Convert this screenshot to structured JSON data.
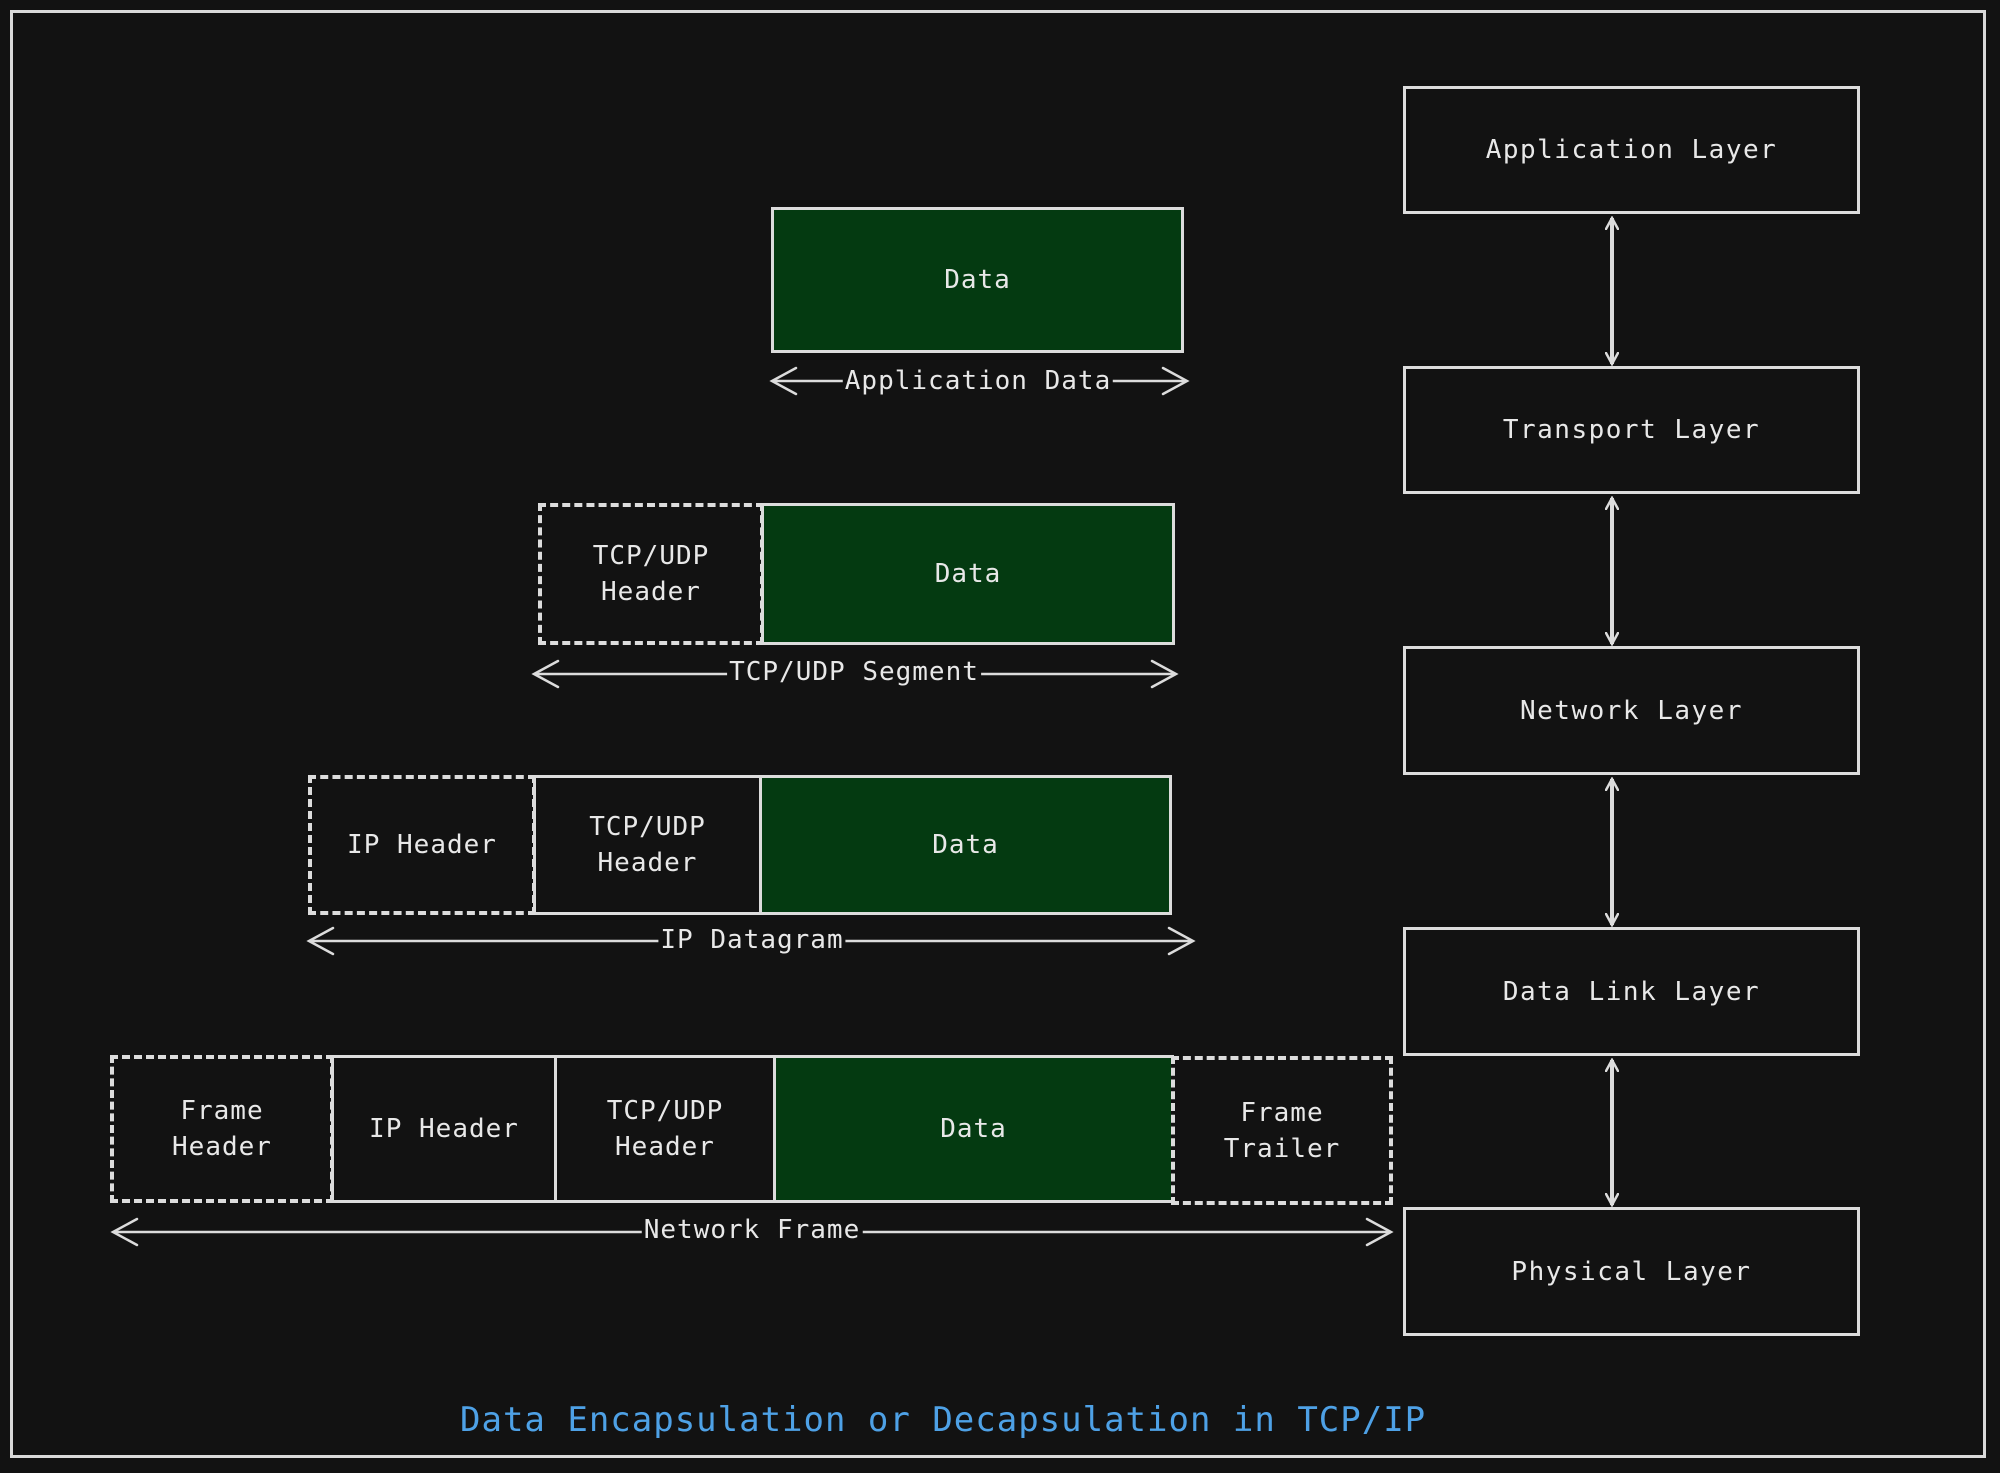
{
  "title": "Data Encapsulation or Decapsulation in TCP/IP",
  "colors": {
    "background": "#121212",
    "stroke": "#dcdcdc",
    "data_fill": "#043a11",
    "title": "#4ea1e6"
  },
  "layers": [
    {
      "label": "Application Layer"
    },
    {
      "label": "Transport Layer"
    },
    {
      "label": "Network Layer"
    },
    {
      "label": "Data Link Layer"
    },
    {
      "label": "Physical Layer"
    }
  ],
  "layer_connectors": "bidirectional",
  "rows": [
    {
      "name": "application",
      "span_label": "Application Data",
      "segments": [
        {
          "label": "Data",
          "style": "data"
        }
      ]
    },
    {
      "name": "transport",
      "span_label": "TCP/UDP Segment",
      "segments": [
        {
          "label": "TCP/UDP\nHeader",
          "style": "dashed"
        },
        {
          "label": "Data",
          "style": "data"
        }
      ]
    },
    {
      "name": "network",
      "span_label": "IP Datagram",
      "segments": [
        {
          "label": "IP Header",
          "style": "dashed"
        },
        {
          "label": "TCP/UDP\nHeader",
          "style": "solid"
        },
        {
          "label": "Data",
          "style": "data"
        }
      ]
    },
    {
      "name": "datalink",
      "span_label": "Network Frame",
      "segments": [
        {
          "label": "Frame\nHeader",
          "style": "dashed"
        },
        {
          "label": "IP Header",
          "style": "solid"
        },
        {
          "label": "TCP/UDP\nHeader",
          "style": "solid"
        },
        {
          "label": "Data",
          "style": "data"
        },
        {
          "label": "Frame\nTrailer",
          "style": "dashed"
        }
      ]
    }
  ]
}
